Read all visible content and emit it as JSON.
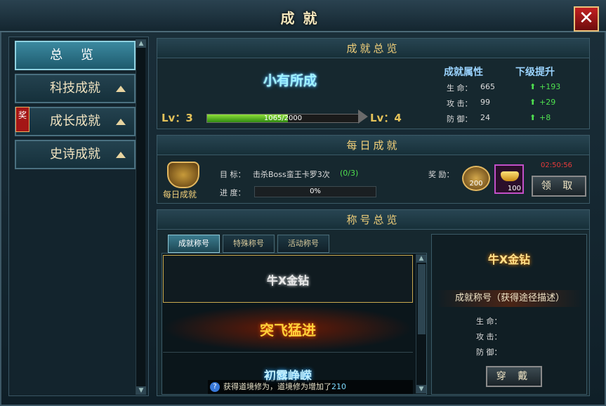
{
  "window": {
    "title": "成就",
    "close_label": "✕"
  },
  "sidebar": {
    "items": [
      {
        "label": "总 览",
        "active": true
      },
      {
        "label": "科技成就",
        "active": false
      },
      {
        "label": "成长成就",
        "active": false,
        "badge": "奖"
      },
      {
        "label": "史诗成就",
        "active": false
      }
    ]
  },
  "overview": {
    "header": "成就总览",
    "emblem": "小有所成",
    "lv_current": "Lv：3",
    "lv_next": "Lv：4",
    "progress_text": "1065/2000",
    "progress_fraction": 0.5325,
    "attr_header": "成就属性",
    "next_header": "下级提升",
    "attrs": [
      {
        "label": "生 命：",
        "value": "665",
        "bonus": "+193"
      },
      {
        "label": "攻 击：",
        "value": "99",
        "bonus": "+29"
      },
      {
        "label": "防 御：",
        "value": "24",
        "bonus": "+8"
      }
    ]
  },
  "daily": {
    "header": "每日成就",
    "icon_label": "每日成就",
    "goal_label": "目  标：",
    "goal_text": "击杀Boss蛮王卡罗3次",
    "goal_count": "(0/3)",
    "progress_label": "进  度：",
    "progress_text": "0%",
    "progress_fraction": 0,
    "reward_label": "奖  励：",
    "reward_badge": "200",
    "reward_count": "100",
    "timer": "02:50:56",
    "claim_button": "领 取"
  },
  "titles": {
    "header": "称号总览",
    "tabs": [
      "成就称号",
      "特殊称号",
      "活动称号"
    ],
    "list": [
      "牛X金钻",
      "突飞猛进",
      "初露峥嵘"
    ],
    "preview_title": "牛X金钻",
    "preview_desc": "成就称号（获得途径描述）",
    "stats": [
      "生  命：",
      "攻  击：",
      "防  御："
    ],
    "wear_button": "穿 戴"
  },
  "notification": {
    "prefix": "获得道境修为，道境修为增加了",
    "amount": "210"
  },
  "colors": {
    "accent_gold": "#f2d07a",
    "progress_green": "#4fb21e",
    "bonus_green": "#4fe04f",
    "timer_red": "#e83a3a",
    "close_red": "#c22020"
  }
}
